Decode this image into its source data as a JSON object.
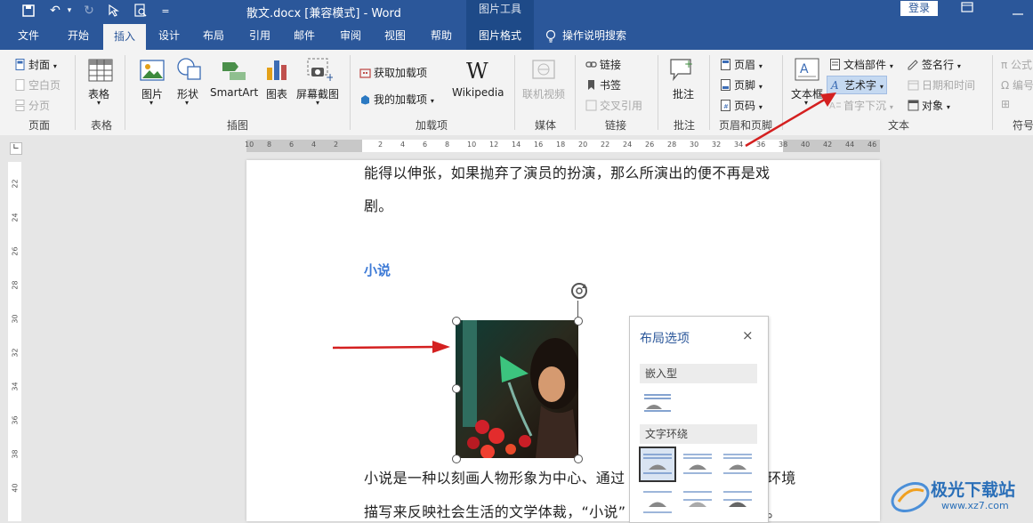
{
  "titlebar": {
    "document_title": "散文.docx [兼容模式]  -  Word",
    "picture_tools": "图片工具",
    "login": "登录",
    "more_qat": "="
  },
  "tabs": [
    "文件",
    "开始",
    "插入",
    "设计",
    "布局",
    "引用",
    "邮件",
    "审阅",
    "视图",
    "帮助",
    "图片格式",
    "操作说明搜索"
  ],
  "ribbon": {
    "pages": {
      "cover": "封面",
      "blank": "空白页",
      "break": "分页",
      "group": "页面"
    },
    "table": {
      "label": "表格",
      "group": "表格"
    },
    "illustrations": {
      "picture": "图片",
      "shapes": "形状",
      "smartart": "SmartArt",
      "chart": "图表",
      "screenshot": "屏幕截图",
      "group": "插图"
    },
    "addins": {
      "get": "获取加载项",
      "mine": "我的加载项",
      "wikipedia": "Wikipedia",
      "group": "加载项"
    },
    "media": {
      "video": "联机视频",
      "group": "媒体"
    },
    "links": {
      "link": "链接",
      "bookmark": "书签",
      "cross": "交叉引用",
      "group": "链接"
    },
    "comments": {
      "comment": "批注",
      "group": "批注"
    },
    "header_footer": {
      "header": "页眉",
      "footer": "页脚",
      "page_number": "页码",
      "group": "页眉和页脚"
    },
    "text": {
      "textbox": "文本框",
      "quickparts": "文档部件",
      "wordart": "艺术字",
      "dropcap": "首字下沉",
      "signature": "签名行",
      "datetime": "日期和时间",
      "object": "对象",
      "group": "文本"
    },
    "symbols": {
      "equation": "公式",
      "symbol": "编号",
      "group": "符号"
    }
  },
  "hruler_ticks": [
    "10",
    "8",
    "6",
    "4",
    "2",
    "",
    "2",
    "4",
    "6",
    "8",
    "10",
    "12",
    "14",
    "16",
    "18",
    "20",
    "22",
    "24",
    "26",
    "28",
    "30",
    "32",
    "34",
    "36",
    "38",
    "40",
    "42",
    "44",
    "46"
  ],
  "vruler_ticks": [
    "22",
    "24",
    "26",
    "28",
    "30",
    "32",
    "34",
    "36",
    "38",
    "40"
  ],
  "document": {
    "line1": "能得以伸张，如果抛弃了演员的扮演，那么所演出的便不再是戏",
    "line2": "剧。",
    "heading": "小说",
    "line3a": "小说是一种以刻画人物形象为中心、通过",
    "line3b": "环境",
    "line4a": "描写来反映社会生活的文学体裁，“小说”",
    "line4b": "。"
  },
  "layout_options": {
    "title": "布局选项",
    "close": "×",
    "inline_section": "嵌入型",
    "wrap_section": "文字环绕"
  },
  "watermark": {
    "name": "极光下载站",
    "url": "www.xz7.com"
  },
  "colors": {
    "accent": "#2b579a",
    "heading": "#3d7ad6",
    "arrow": "#d42020"
  }
}
